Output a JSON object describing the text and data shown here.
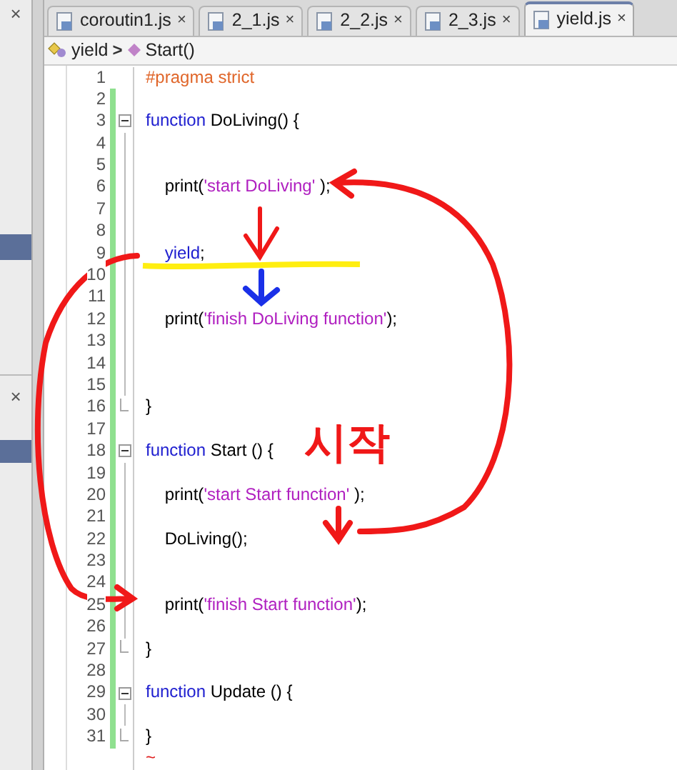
{
  "side_panel": {
    "close_top": "×",
    "close_bottom": "×"
  },
  "tabs": [
    {
      "label": "coroutin1.js",
      "close": "×",
      "selected": false
    },
    {
      "label": "2_1.js",
      "close": "×",
      "selected": false
    },
    {
      "label": "2_2.js",
      "close": "×",
      "selected": false
    },
    {
      "label": "2_3.js",
      "close": "×",
      "selected": false
    },
    {
      "label": "yield.js",
      "close": "×",
      "selected": true
    }
  ],
  "breadcrumb": {
    "file": "yield",
    "separator": ">",
    "member": "Start()"
  },
  "lines": [
    {
      "number": "1",
      "changed": false,
      "kind": "plain",
      "segments": [
        {
          "kind": "directive",
          "text": "#pragma strict"
        }
      ]
    },
    {
      "number": "2",
      "changed": true,
      "kind": "plain"
    },
    {
      "number": "3",
      "changed": true,
      "kind": "open",
      "segments": [
        {
          "kind": "keyword",
          "text": "function"
        },
        {
          "kind": "plain",
          "text": " DoLiving() {"
        }
      ]
    },
    {
      "number": "4",
      "changed": true,
      "kind": "inner"
    },
    {
      "number": "5",
      "changed": true,
      "kind": "inner"
    },
    {
      "number": "6",
      "changed": true,
      "kind": "inner",
      "segments": [
        {
          "kind": "plain",
          "text": "    print("
        },
        {
          "kind": "string",
          "text": "'start DoLiving'"
        },
        {
          "kind": "plain",
          "text": " );"
        }
      ]
    },
    {
      "number": "7",
      "changed": true,
      "kind": "inner"
    },
    {
      "number": "8",
      "changed": true,
      "kind": "inner"
    },
    {
      "number": "9",
      "changed": true,
      "kind": "inner",
      "segments": [
        {
          "kind": "keyword",
          "text": "    yield"
        },
        {
          "kind": "plain",
          "text": ";"
        }
      ]
    },
    {
      "number": "10",
      "changed": true,
      "kind": "inner"
    },
    {
      "number": "11",
      "changed": true,
      "kind": "inner"
    },
    {
      "number": "12",
      "changed": true,
      "kind": "inner",
      "segments": [
        {
          "kind": "plain",
          "text": "    print("
        },
        {
          "kind": "string",
          "text": "'finish DoLiving function'"
        },
        {
          "kind": "plain",
          "text": ");"
        }
      ]
    },
    {
      "number": "13",
      "changed": true,
      "kind": "inner"
    },
    {
      "number": "14",
      "changed": true,
      "kind": "inner"
    },
    {
      "number": "15",
      "changed": true,
      "kind": "inner"
    },
    {
      "number": "16",
      "changed": true,
      "kind": "close",
      "segments": [
        {
          "kind": "plain",
          "text": "}"
        }
      ]
    },
    {
      "number": "17",
      "changed": true,
      "kind": "plain"
    },
    {
      "number": "18",
      "changed": true,
      "kind": "open",
      "segments": [
        {
          "kind": "keyword",
          "text": "function"
        },
        {
          "kind": "plain",
          "text": " Start () {"
        }
      ]
    },
    {
      "number": "19",
      "changed": true,
      "kind": "inner"
    },
    {
      "number": "20",
      "changed": true,
      "kind": "inner",
      "segments": [
        {
          "kind": "plain",
          "text": "    print("
        },
        {
          "kind": "string",
          "text": "'start Start function'"
        },
        {
          "kind": "plain",
          "text": " );"
        }
      ]
    },
    {
      "number": "21",
      "changed": true,
      "kind": "inner"
    },
    {
      "number": "22",
      "changed": true,
      "kind": "inner",
      "segments": [
        {
          "kind": "plain",
          "text": "    DoLiving();"
        }
      ]
    },
    {
      "number": "23",
      "changed": true,
      "kind": "inner"
    },
    {
      "number": "24",
      "changed": true,
      "kind": "inner"
    },
    {
      "number": "25",
      "changed": true,
      "kind": "inner",
      "segments": [
        {
          "kind": "plain",
          "text": "    print("
        },
        {
          "kind": "string",
          "text": "'finish Start function'"
        },
        {
          "kind": "plain",
          "text": ");"
        }
      ]
    },
    {
      "number": "26",
      "changed": true,
      "kind": "inner"
    },
    {
      "number": "27",
      "changed": true,
      "kind": "close",
      "segments": [
        {
          "kind": "plain",
          "text": "}"
        }
      ]
    },
    {
      "number": "28",
      "changed": true,
      "kind": "plain"
    },
    {
      "number": "29",
      "changed": true,
      "kind": "open",
      "segments": [
        {
          "kind": "keyword",
          "text": "function"
        },
        {
          "kind": "plain",
          "text": " Update () {"
        }
      ]
    },
    {
      "number": "30",
      "changed": true,
      "kind": "inner"
    },
    {
      "number": "31",
      "changed": true,
      "kind": "close",
      "segments": [
        {
          "kind": "plain",
          "text": "}"
        }
      ]
    }
  ],
  "eof_marker": "~",
  "annotation": {
    "label": "시작"
  }
}
